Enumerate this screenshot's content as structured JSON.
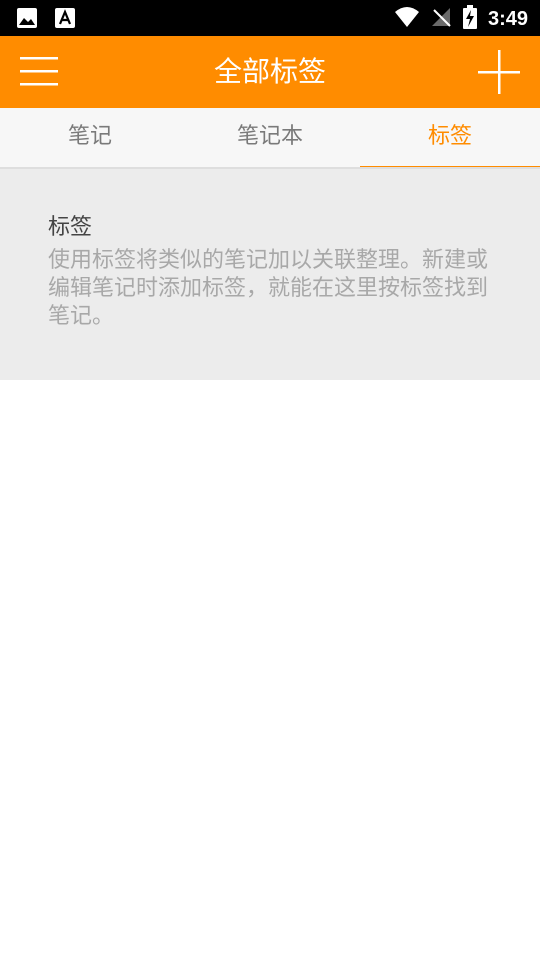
{
  "status_bar": {
    "time": "3:49",
    "left_icons": [
      "image-icon",
      "font-icon"
    ],
    "right_icons": [
      "wifi-icon",
      "no-signal-icon",
      "battery-charging-icon"
    ]
  },
  "app_bar": {
    "title": "全部标签",
    "menu_icon": "menu-icon",
    "add_icon": "plus-icon",
    "color": "#ff8c00"
  },
  "tabs": [
    {
      "label": "笔记",
      "active": false
    },
    {
      "label": "笔记本",
      "active": false
    },
    {
      "label": "标签",
      "active": true
    }
  ],
  "empty_state": {
    "title": "标签",
    "description": "使用标签将类似的笔记加以关联整理。新建或编辑笔记时添加标签，就能在这里按标签找到笔记。"
  }
}
